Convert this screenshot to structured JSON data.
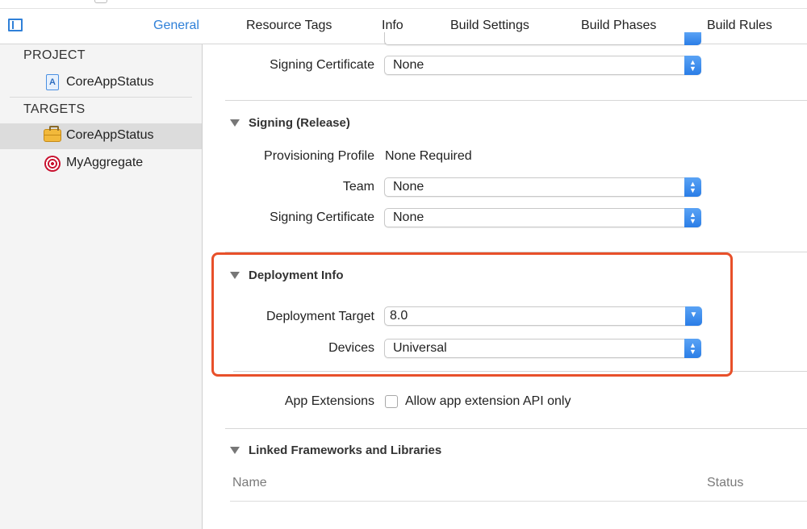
{
  "tabs": [
    "General",
    "Resource Tags",
    "Info",
    "Build Settings",
    "Build Phases",
    "Build Rules"
  ],
  "navigator": {
    "project_header": "PROJECT",
    "project_item": "CoreAppStatus",
    "targets_header": "TARGETS",
    "targets": [
      "CoreAppStatus",
      "MyAggregate"
    ]
  },
  "signing_debug": {
    "signing_certificate_label": "Signing Certificate",
    "signing_certificate_value": "None"
  },
  "signing_release": {
    "title": "Signing (Release)",
    "provisioning_label": "Provisioning Profile",
    "provisioning_value": "None Required",
    "team_label": "Team",
    "team_value": "None",
    "signing_certificate_label": "Signing Certificate",
    "signing_certificate_value": "None"
  },
  "deployment": {
    "title": "Deployment Info",
    "target_label": "Deployment Target",
    "target_value": "8.0",
    "devices_label": "Devices",
    "devices_value": "Universal"
  },
  "app_extensions": {
    "label": "App Extensions",
    "checkbox_label": "Allow app extension API only",
    "checked": false
  },
  "frameworks": {
    "title": "Linked Frameworks and Libraries",
    "columns": [
      "Name",
      "Status"
    ]
  },
  "colors": {
    "accent": "#2f80d8",
    "highlight": "#e8502a"
  }
}
